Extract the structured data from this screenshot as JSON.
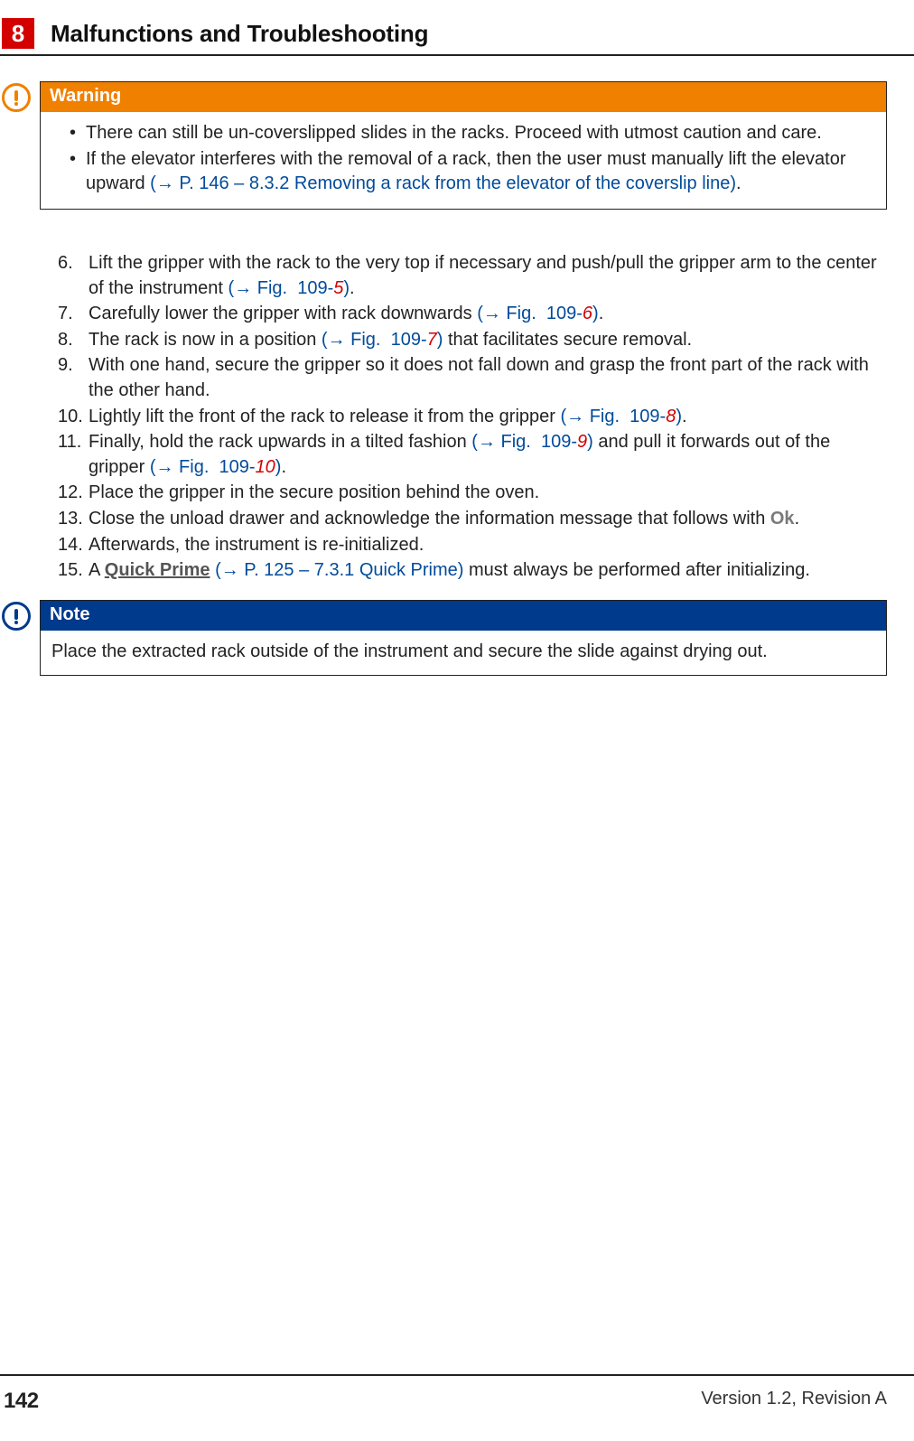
{
  "header": {
    "chapter_number": "8",
    "chapter_title": "Malfunctions and Troubleshooting"
  },
  "footer": {
    "page_number": "142",
    "version": "Version 1.2, Revision A"
  },
  "warning": {
    "title": "Warning",
    "bullet1": "There can still be un-coverslipped slides in the racks. Proceed with utmost caution and care.",
    "bullet2_a": "If the elevator interferes with the removal of a rack, then the user must manually lift the elevator upward ",
    "bullet2_link_open": "(",
    "bullet2_link": "→ P. 146 – 8.3.2 Removing a rack from the elevator of the coverslip line",
    "bullet2_link_close": ")",
    "bullet2_end": "."
  },
  "steps": {
    "s6": {
      "n": "6.",
      "a": "Lift the gripper with the rack to the very top if necessary and push/pull the gripper arm to the center of the instrument ",
      "l1o": "(",
      "l1": "→ Fig.  109-",
      "l1n": "5",
      "l1c": ")",
      "z": "."
    },
    "s7": {
      "n": "7.",
      "a": "Carefully lower the gripper with rack downwards ",
      "l1o": "(",
      "l1": "→ Fig.  109-",
      "l1n": "6",
      "l1c": ")",
      "z": "."
    },
    "s8": {
      "n": "8.",
      "a": "The rack is now in a position ",
      "l1o": "(",
      "l1": "→ Fig.  109-",
      "l1n": "7",
      "l1c": ")",
      "z": " that facilitates secure removal."
    },
    "s9": {
      "n": "9.",
      "a": "With one hand, secure the gripper so it does not fall down and grasp the front part of the rack with the other hand."
    },
    "s10": {
      "n": "10.",
      "a": "Lightly lift the front of the rack to release it from the gripper ",
      "l1o": "(",
      "l1": "→ Fig.  109-",
      "l1n": "8",
      "l1c": ")",
      "z": "."
    },
    "s11": {
      "n": "11.",
      "a": "Finally, hold the rack upwards in a tilted fashion ",
      "l1o": "(",
      "l1": "→ Fig.  109-",
      "l1n": "9",
      "l1c": ")",
      "b": " and pull it forwards out of the gripper ",
      "l2o": "(",
      "l2": "→ Fig.  109-",
      "l2n": "10",
      "l2c": ")",
      "z": "."
    },
    "s12": {
      "n": "12.",
      "a": "Place the gripper in the secure position behind the oven."
    },
    "s13": {
      "n": "13.",
      "a": "Close the unload drawer and acknowledge the information message that follows with ",
      "ui": "Ok",
      "z": "."
    },
    "s14": {
      "n": "14.",
      "a": "Afterwards, the instrument is re-initialized."
    },
    "s15": {
      "n": "15.",
      "a": "A ",
      "qp": "Quick Prime",
      "sp": " ",
      "l1o": "(",
      "l1": "→ P. 125 – 7.3.1 Quick Prime",
      "l1c": ")",
      "z": " must always be performed after initializing."
    }
  },
  "note": {
    "title": "Note",
    "body": "Place the extracted rack outside of the instrument and secure the slide against drying out."
  }
}
